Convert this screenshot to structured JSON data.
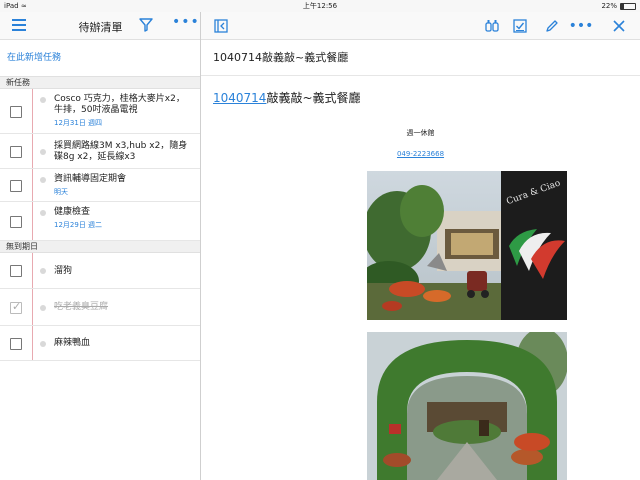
{
  "status_bar": {
    "device": "iPad",
    "wifi_icon": "wifi-icon",
    "time": "上午12:56",
    "battery_percent": "22%",
    "battery_level": 0.22
  },
  "list_pane": {
    "title": "待辦清單",
    "add_task_label": "在此新增任務",
    "sections": [
      {
        "label": "新任務",
        "tasks": [
          {
            "text": "Cosco 巧克力，桂格大麥片x2，牛排，50吋液晶電視",
            "sub": "12月31日 週四",
            "done": false
          },
          {
            "text": "採買網路線3M x3,hub x2，隨身碟8g x2，延長線x3",
            "sub": "",
            "done": false
          },
          {
            "text": "資訊輔導固定期會",
            "sub": "明天",
            "done": false
          },
          {
            "text": "健康檢查",
            "sub": "12月29日 週二",
            "done": false
          }
        ]
      },
      {
        "label": "無到期日",
        "tasks": [
          {
            "text": "溜狗",
            "sub": "",
            "done": false
          },
          {
            "text": "吃老義臭豆腐",
            "sub": "",
            "done": true
          },
          {
            "text": "麻辣鴨血",
            "sub": "",
            "done": false
          }
        ]
      }
    ]
  },
  "detail_pane": {
    "title": "1040714敲義敲~義式餐廳",
    "heading_link": "1040714",
    "heading_rest": "敲義敲~義式餐廳",
    "closed_note": "週一休館",
    "phone": "049-2223668",
    "photo_sign_text": "Cura & Ciao"
  },
  "colors": {
    "accent": "#2b82d9",
    "margin_line": "#e8a9b0"
  }
}
